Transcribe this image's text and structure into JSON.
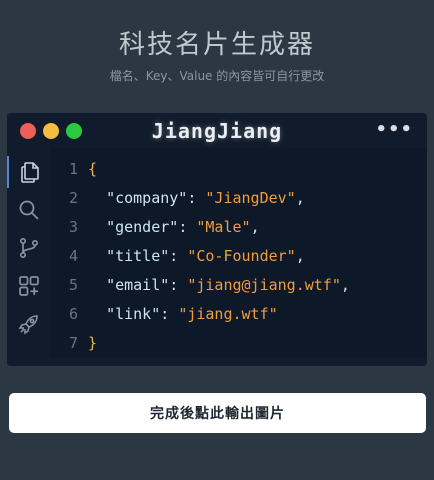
{
  "header": {
    "title": "科技名片生成器",
    "subtitle": "檔名、Key、Value 的內容皆可自行更改"
  },
  "window": {
    "title": "JiangJiang",
    "more_label": "•••",
    "traffic_lights": {
      "close": "#ef5f57",
      "minimize": "#f5bd3f",
      "zoom": "#2bc840"
    }
  },
  "activity_bar": {
    "icons": [
      "files-icon",
      "search-icon",
      "source-control-icon",
      "extensions-icon",
      "rocket-icon"
    ],
    "active": "files-icon"
  },
  "editor": {
    "lines": [
      {
        "num": "1",
        "open": "{"
      },
      {
        "num": "2",
        "key": "\"company\"",
        "value": "\"JiangDev\"",
        "comma": ","
      },
      {
        "num": "3",
        "key": "\"gender\"",
        "value": "\"Male\"",
        "comma": ","
      },
      {
        "num": "4",
        "key": "\"title\"",
        "value": "\"Co-Founder\"",
        "comma": ","
      },
      {
        "num": "5",
        "key": "\"email\"",
        "value": "\"jiang@jiang.wtf\"",
        "comma": ","
      },
      {
        "num": "6",
        "key": "\"link\"",
        "value": "\"jiang.wtf\"",
        "comma": ""
      },
      {
        "num": "7",
        "close": "}"
      }
    ],
    "colors": {
      "brace": "#e6b450",
      "key": "#cfe3f3",
      "string": "#f39c3c",
      "line_number": "#6a7583"
    }
  },
  "action": {
    "export_label": "完成後點此輸出圖片"
  }
}
